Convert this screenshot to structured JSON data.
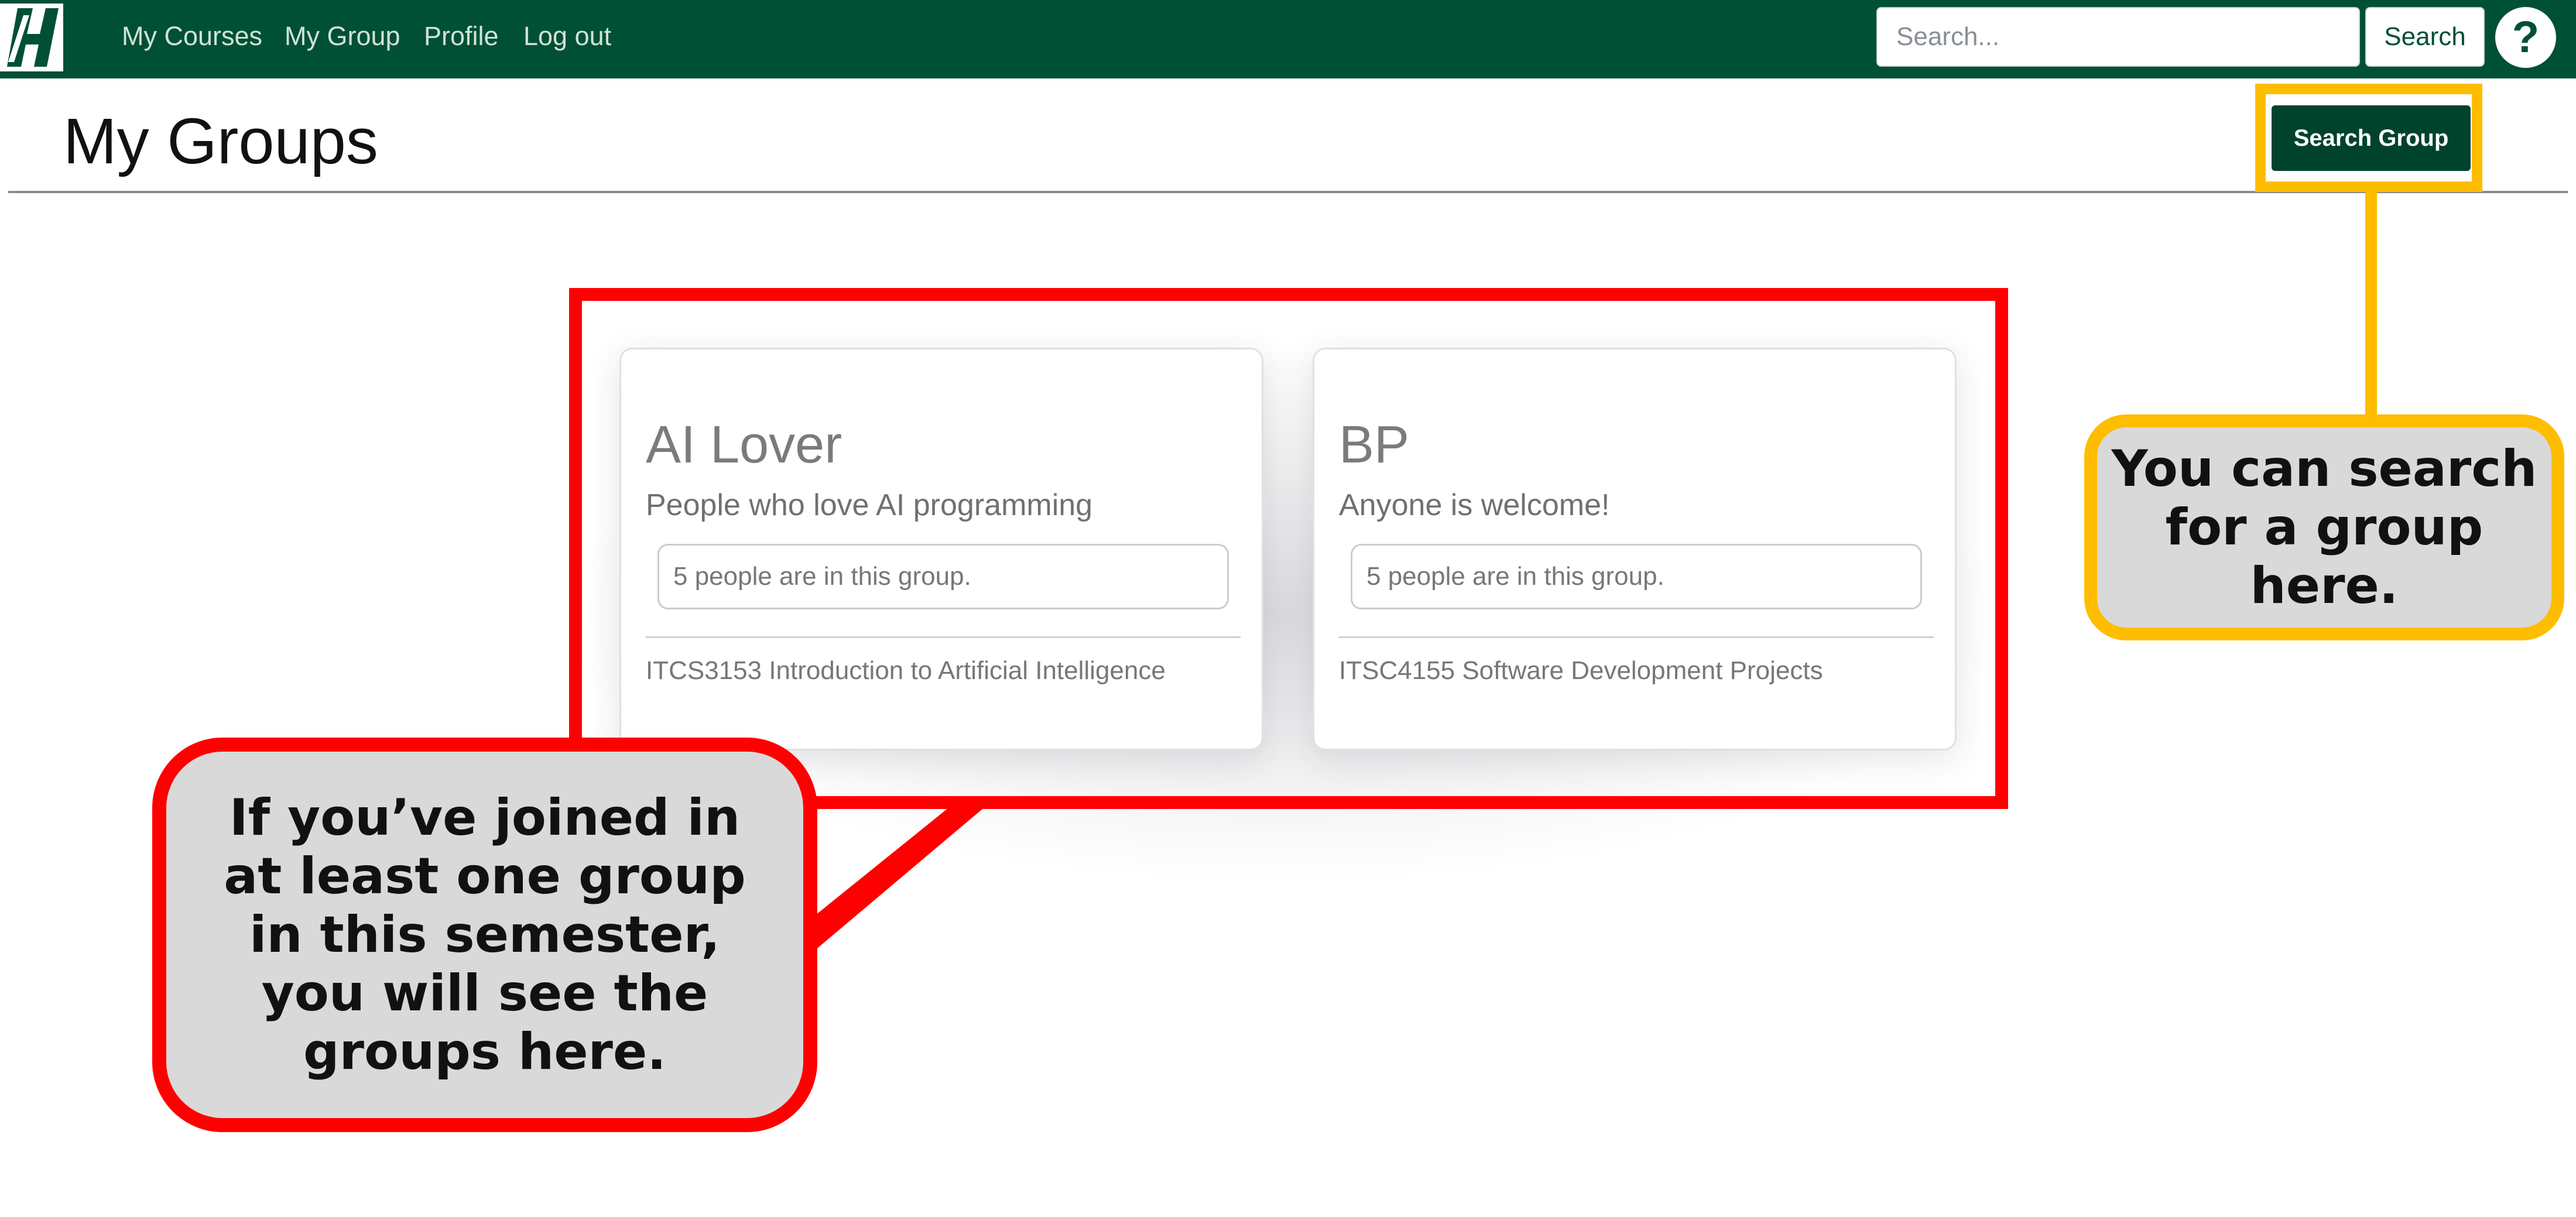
{
  "navbar": {
    "links": {
      "my_courses": "My Courses",
      "my_group": "My Group",
      "profile": "Profile",
      "log_out": "Log out"
    },
    "search": {
      "placeholder": "Search...",
      "button_label": "Search"
    },
    "help_label": "?"
  },
  "header": {
    "title": "My Groups",
    "search_group_label": "Search Group"
  },
  "groups": [
    {
      "name": "AI Lover",
      "description": "People who love AI programming",
      "members": "5 people are in this group.",
      "course": "ITCS3153 Introduction to Artificial Intelligence"
    },
    {
      "name": "BP",
      "description": "Anyone is welcome!",
      "members": "5 people are in this group.",
      "course": "ITSC4155 Software Development Projects"
    }
  ],
  "annotations": {
    "search_callout": "You can search for a group here.",
    "groups_callout": "If you’ve joined in at least one group in this semester, you will see the groups here."
  },
  "colors": {
    "navbar_green": "#005035",
    "button_dark_green": "#00432c",
    "callout_red": "#ff0000",
    "callout_yellow": "#ffbd00",
    "callout_fill": "#d9d9d9"
  },
  "icons": {
    "logo": "university-logo-icon",
    "help": "question-mark-icon"
  }
}
